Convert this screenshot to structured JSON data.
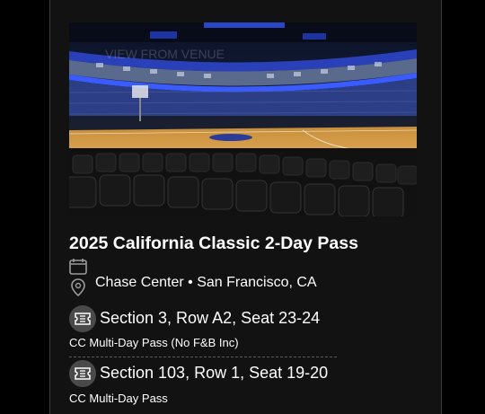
{
  "event": {
    "title": "2025 California Classic 2-Day Pass",
    "venue_line": "Chase Center • San Francisco, CA"
  },
  "image": {
    "icon": "arena-seat-view-photo",
    "watermark": "VIEW FROM VENUE"
  },
  "tickets": [
    {
      "seat": "Section 3, Row A2, Seat 23-24",
      "pass_type": "CC Multi-Day Pass (No F&B Inc)"
    },
    {
      "seat": "Section 103, Row 1, Seat 19-20",
      "pass_type": "CC Multi-Day Pass"
    }
  ],
  "colors": {
    "background": "#000000",
    "card": "#121212",
    "court": "#d9a24a",
    "badge": "#4a4a4a",
    "text": "#ffffff"
  }
}
